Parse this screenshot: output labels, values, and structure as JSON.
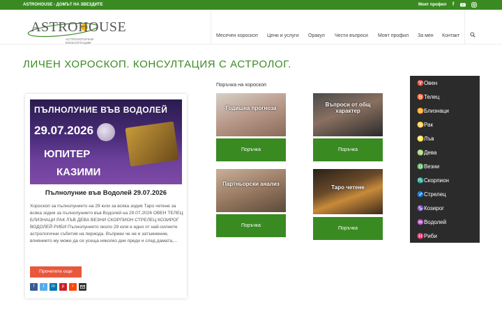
{
  "topbar": {
    "tagline": "ASTROHOUSE - ДОМЪТ НА ЗВЕЗДИТЕ",
    "profile": "Моят профил",
    "social_icons": [
      "facebook-icon",
      "youtube-icon",
      "instagram-icon"
    ]
  },
  "brand": {
    "name": "ASTROHOUSE",
    "subtitle": "АСТРОЛОГИЧНИ КОНСУЛТАЦИИ",
    "accent_color": "#3a8a22",
    "button_color": "#e8583d"
  },
  "nav": {
    "items": [
      "Месечен хороскоп",
      "Цени и услуги",
      "Оракул",
      "Чести въпроси",
      "Моят профил",
      "За мен",
      "Контакт"
    ],
    "search_icon": "search-icon"
  },
  "page": {
    "title": "ЛИЧЕН ХОРОСКОП. КОНСУЛТАЦИЯ С АСТРОЛОГ."
  },
  "post": {
    "image_text": [
      "ПЪЛНОЛУНИЕ ВЪВ ВОДОЛЕЙ",
      "29.07.2026",
      "ЮПИТЕР",
      "КАЗИМИ"
    ],
    "title": "Пълнолуние във Водолей 29.07.2026",
    "excerpt": "Хороскоп за пълнолунието на 29 юли за всяка зодия Таро четене за всяка зодия за пълнолунието във Водолей на 29.07.2026 ОВЕН ТЕЛЕЦ БЛИЗНАЦИ РАК ЛЪВ ДЕВА ВЕЗНИ СКОРПИОН СТРЕЛЕЦ КОЗИРОГ ВОДОЛЕЙ РИБИ Пълнолунието около 29 юли е едно от най-силните астрологични събития на периода. Въпреки че не е затъмнение, влиянието му може да се усеща няколко дни преди и след дамата,...",
    "more_label": "Прочетете още",
    "share_icons": [
      "facebook-icon",
      "twitter-icon",
      "linkedin-icon",
      "pinterest-icon",
      "reddit-icon",
      "mail-icon"
    ]
  },
  "orders": {
    "label": "Поръчка на хороскоп",
    "products": [
      {
        "caption": "Годишна прогноза",
        "button": "Поръчка"
      },
      {
        "caption": "Въпроси от общ характер",
        "button": "Поръчка"
      },
      {
        "caption": "Партньорски анализ",
        "button": "Поръчка"
      },
      {
        "caption": "Таро четене",
        "button": "Поръчка"
      }
    ]
  },
  "zodiac": {
    "signs": [
      "♈Овен",
      "♉Телец",
      "♊Близнаци",
      "♋Рак",
      "♌Лъв",
      "♍Дева",
      "♎Везни",
      "♏Скорпион",
      "♐Стрелец",
      "♑Козирог",
      "♒Водолей",
      "♓Риби"
    ]
  }
}
